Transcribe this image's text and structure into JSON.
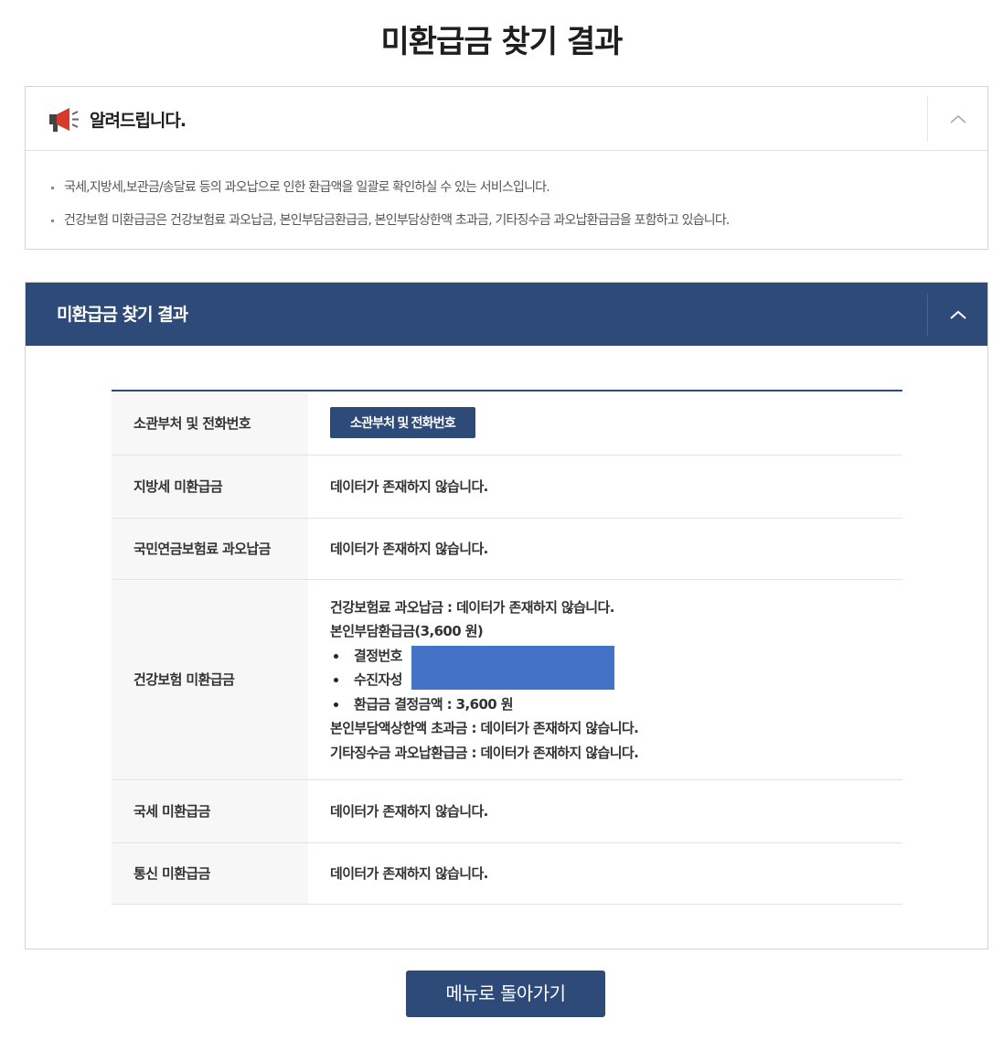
{
  "page": {
    "title": "미환급금 찾기 결과"
  },
  "notice": {
    "title": "알려드립니다.",
    "icon": "megaphone-icon",
    "lines": [
      "국세,지방세,보관금/송달료 등의 과오납으로 인한 환급액을 일괄로 확인하실 수 있는 서비스입니다.",
      "건강보험 미환급금은 건강보험료 과오납금, 본인부담금환급금, 본인부담상한액 초과금, 기타징수금 과오납환급금을 포함하고 있습니다."
    ]
  },
  "result": {
    "title": "미환급금 찾기 결과",
    "rows": [
      {
        "label": "소관부처 및 전화번호",
        "button_label": "소관부처 및 전화번호"
      },
      {
        "label": "지방세 미환급금",
        "value": "데이터가 존재하지 않습니다."
      },
      {
        "label": "국민연금보험료 과오납금",
        "value": "데이터가 존재하지 않습니다."
      },
      {
        "label": "건강보험 미환급금",
        "line1": "건강보험료 과오납금 : 데이터가 존재하지 않습니다.",
        "line2": "본인부담환급금(3,600 원)",
        "bullets": [
          "결정번호",
          "수진자성",
          "환급금 결정금액 : 3,600 원"
        ],
        "line3": "본인부담액상한액 초과금 : 데이터가 존재하지 않습니다.",
        "line4": "기타징수금 과오납환급금 : 데이터가 존재하지 않습니다."
      },
      {
        "label": "국세 미환급금",
        "value": "데이터가 존재하지 않습니다."
      },
      {
        "label": "통신 미환급금",
        "value": "데이터가 존재하지 않습니다."
      }
    ]
  },
  "footer": {
    "back_label": "메뉴로 돌아가기"
  },
  "colors": {
    "primary": "#2e4a78",
    "redaction": "#4472c4"
  }
}
